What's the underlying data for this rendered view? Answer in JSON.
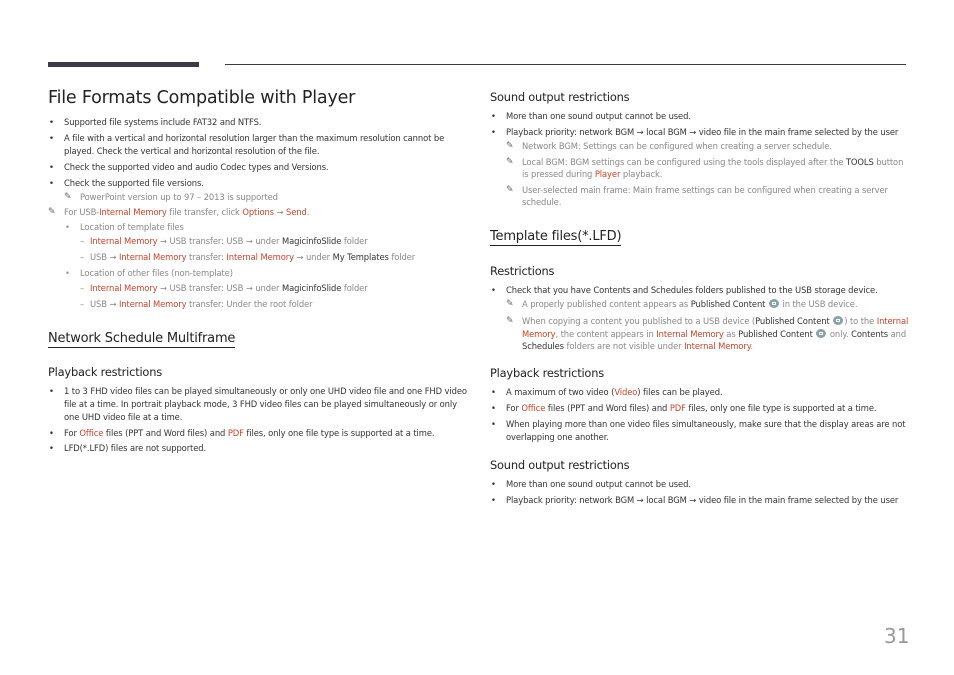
{
  "page": {
    "title": "File Formats Compatible with Player",
    "page_number": "31"
  },
  "left": {
    "bullets": [
      "Supported file systems include FAT32 and NTFS.",
      "A file with a vertical and horizontal resolution larger than the maximum resolution cannot be played. Check the vertical and horizontal resolution of the file.",
      "Check the supported video and audio Codec types and Versions.",
      "Check the supported file versions."
    ],
    "note_powerpoint": "PowerPoint version up to 97 – 2013 is supported",
    "usb_note": {
      "prefix": "For USB-",
      "internal_memory": "Internal Memory",
      "mid": " file transfer, click ",
      "options": "Options",
      "arrow": " → ",
      "send": "Send",
      "end": "."
    },
    "template_location": {
      "label": "Location of template files",
      "line1": {
        "a": "Internal Memory",
        "b": " → USB transfer: USB → under ",
        "c": "MagicinfoSlide",
        "d": " folder"
      },
      "line2": {
        "a": "USB → ",
        "b": "Internal Memory",
        "c": " transfer: ",
        "d": "Internal Memory",
        "e": " → under ",
        "f": "My Templates",
        "g": " folder"
      }
    },
    "other_location": {
      "label": "Location of other files (non-template)",
      "line1": {
        "a": "Internal Memory",
        "b": " → USB transfer: USB → under ",
        "c": "MagicinfoSlide",
        "d": " folder"
      },
      "line2": {
        "a": "USB → ",
        "b": "Internal Memory",
        "c": " transfer: Under the root folder"
      }
    },
    "nsm": {
      "heading": "Network Schedule Multiframe",
      "playback_heading": "Playback restrictions",
      "bullet1": "1 to 3 FHD video files can be played simultaneously or only one UHD video file and one FHD video file at a time. In portrait playback mode, 3 FHD video files can be played simultaneously or only one UHD video file at a time.",
      "bullet2": {
        "a": "For ",
        "b": "Office",
        "c": " files (PPT and Word files) and ",
        "d": "PDF",
        "e": " files, only one file type is supported at a time."
      },
      "bullet3": "LFD(*.LFD) files are not supported."
    }
  },
  "right": {
    "sound1": {
      "heading": "Sound output restrictions",
      "bullet1": "More than one sound output cannot be used.",
      "bullet2": "Playback priority: network BGM → local BGM → video file in the main frame selected by the user",
      "note1": "Network BGM: Settings can be configured when creating a server schedule.",
      "note2": {
        "a": "Local BGM: BGM settings can be configured using the tools displayed after the ",
        "b": "TOOLS",
        "c": " button is pressed during ",
        "d": "Player",
        "e": " playback."
      },
      "note3": "User-selected main frame: Main frame settings can be configured when creating a server schedule."
    },
    "template": {
      "heading": "Template files(*.LFD)",
      "restrictions_heading": "Restrictions",
      "bullet1": {
        "a": "Check that you have ",
        "b": "Contents",
        "c": " and ",
        "d": "Schedules",
        "e": " folders published to the USB storage device."
      },
      "note1": {
        "a": "A properly published content appears as ",
        "b": "Published Content",
        "c": " in the USB device."
      },
      "note2": {
        "a": "When copying a content you published to a USB device (",
        "b": "Published Content",
        "c": ") to the ",
        "d": "Internal Memory",
        "e": ", the content appears in ",
        "f": "Internal Memory",
        "g": " as ",
        "h": "Published Content",
        "i": " only. ",
        "j": "Contents",
        "k": " and ",
        "l": "Schedules",
        "m": " folders are not visible under ",
        "n": "Internal Memory",
        "o": "."
      },
      "playback_heading": "Playback restrictions",
      "pb1": {
        "a": "A maximum of two video (",
        "b": "Video",
        "c": ") files can be played."
      },
      "pb2": {
        "a": "For ",
        "b": "Office",
        "c": " files (PPT and Word files) and ",
        "d": "PDF",
        "e": " files, only one file type is supported at a time."
      },
      "pb3": "When playing more than one video files simultaneously, make sure that the display areas are not overlapping one another."
    },
    "sound2": {
      "heading": "Sound output restrictions",
      "bullet1": "More than one sound output cannot be used.",
      "bullet2": "Playback priority: network BGM → local BGM → video file in the main frame selected by the user"
    }
  },
  "icons": {
    "note": "pencil-icon",
    "published": "published-content-icon"
  },
  "colors": {
    "highlight": "#c8442a",
    "header_bar": "#3c3c48",
    "note_text": "#888888"
  }
}
